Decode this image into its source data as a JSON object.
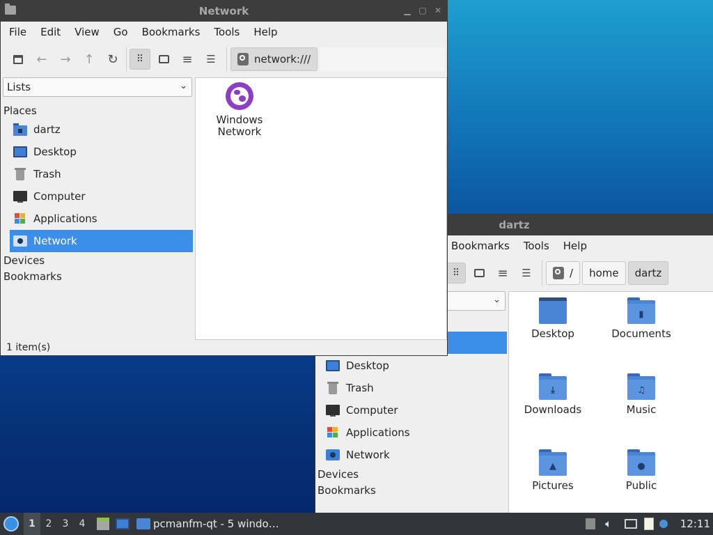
{
  "windows": {
    "network": {
      "title": "Network",
      "menu": [
        "File",
        "Edit",
        "View",
        "Go",
        "Bookmarks",
        "Tools",
        "Help"
      ],
      "path": "network:///",
      "combo": "Lists",
      "places_header": "Places",
      "places": [
        {
          "label": "dartz",
          "icon": "home-folder-icon"
        },
        {
          "label": "Desktop",
          "icon": "desktop-icon"
        },
        {
          "label": "Trash",
          "icon": "trash-icon"
        },
        {
          "label": "Computer",
          "icon": "computer-icon"
        },
        {
          "label": "Applications",
          "icon": "applications-icon"
        },
        {
          "label": "Network",
          "icon": "network-icon",
          "selected": true
        }
      ],
      "devices": "Devices",
      "bookmarks": "Bookmarks",
      "items": [
        {
          "label_line1": "Windows",
          "label_line2": "Network",
          "icon": "windows-network-icon"
        }
      ],
      "status": "1 item(s)"
    },
    "dartz": {
      "title": "dartz",
      "menu": [
        "Bookmarks",
        "Tools",
        "Help"
      ],
      "path_root": "/",
      "path_parts": [
        "home",
        "dartz"
      ],
      "places": [
        {
          "label": "Desktop",
          "icon": "desktop-icon"
        },
        {
          "label": "Trash",
          "icon": "trash-icon"
        },
        {
          "label": "Computer",
          "icon": "computer-icon"
        },
        {
          "label": "Applications",
          "icon": "applications-icon"
        },
        {
          "label": "Network",
          "icon": "network-icon"
        }
      ],
      "devices": "Devices",
      "bookmarks": "Bookmarks",
      "folders": [
        {
          "label": "Desktop",
          "icon": "desktop-folder-icon"
        },
        {
          "label": "Documents",
          "icon": "documents-folder-icon"
        },
        {
          "label": "Downloads",
          "icon": "downloads-folder-icon"
        },
        {
          "label": "Music",
          "icon": "music-folder-icon"
        },
        {
          "label": "Pictures",
          "icon": "pictures-folder-icon"
        },
        {
          "label": "Public",
          "icon": "public-folder-icon"
        }
      ]
    }
  },
  "taskbar": {
    "workspaces": [
      "1",
      "2",
      "3",
      "4"
    ],
    "current_workspace": "1",
    "task_label": "pcmanfm-qt - 5 windo…",
    "clock": "12:11"
  },
  "colors": {
    "selection": "#3d8ee6",
    "folder": "#4a84d4",
    "taskbar": "#32353a",
    "titlebar": "#3d3d3d"
  }
}
